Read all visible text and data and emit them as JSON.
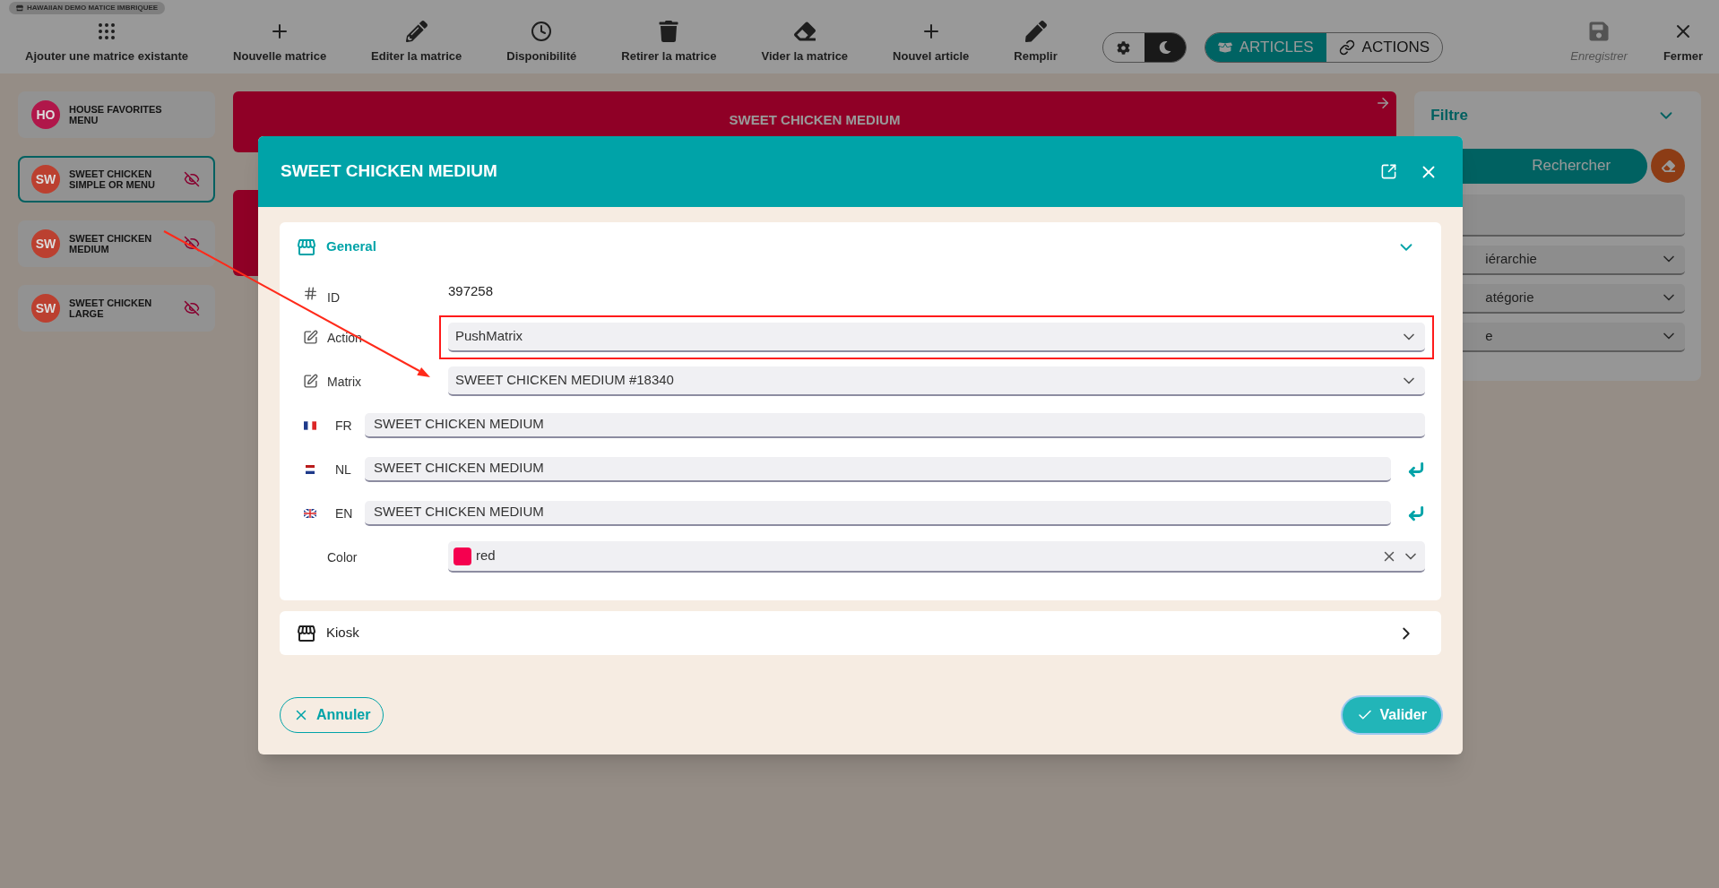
{
  "app_title": "HAWAIIAN DEMO MATICE IMBRIQUEE",
  "toolbar": [
    {
      "label": "Ajouter une matrice existante",
      "disabled": false
    },
    {
      "label": "Nouvelle matrice",
      "disabled": false
    },
    {
      "label": "Editer la matrice",
      "disabled": false
    },
    {
      "label": "Disponibilité",
      "disabled": false
    },
    {
      "label": "Retirer la matrice",
      "disabled": false
    },
    {
      "label": "Vider la matrice",
      "disabled": false
    },
    {
      "label": "Nouvel article",
      "disabled": false
    },
    {
      "label": "Remplir",
      "disabled": false
    }
  ],
  "theme_options": [
    {
      "selected": false
    },
    {
      "selected": true
    }
  ],
  "view_tabs": [
    {
      "label": "ARTICLES",
      "selected": true
    },
    {
      "label": "ACTIONS",
      "selected": false
    }
  ],
  "window_actions": [
    {
      "label": "Enregistrer",
      "disabled": true
    },
    {
      "label": "Fermer",
      "disabled": false
    }
  ],
  "sidebar": [
    {
      "initials": "HO",
      "name": "HOUSE FAVORITES MENU",
      "color": "#b0174a",
      "selected": false,
      "hidden": false
    },
    {
      "initials": "SW",
      "name": "SWEET CHICKEN SIMPLE OR MENU",
      "color": "#bb4030",
      "selected": true,
      "hidden": true
    },
    {
      "initials": "SW",
      "name": "SWEET CHICKEN MEDIUM",
      "color": "#bb4030",
      "selected": false,
      "hidden": true
    },
    {
      "initials": "SW",
      "name": "SWEET CHICKEN LARGE",
      "color": "#bb4030",
      "selected": false,
      "hidden": true
    }
  ],
  "matrix_cards": [
    {
      "title": "SWEET CHICKEN MEDIUM"
    }
  ],
  "filter": {
    "title": "Filtre",
    "expanded": true,
    "search_button": "Rechercher",
    "fields": [
      {
        "kind": "input"
      },
      {
        "kind": "select",
        "value": "iérarchie"
      },
      {
        "kind": "select",
        "value": "atégorie"
      },
      {
        "kind": "select",
        "value": "e"
      }
    ]
  },
  "dialog": {
    "title": "SWEET CHICKEN MEDIUM",
    "sections": [
      {
        "title": "General",
        "expanded": true,
        "fields": [
          {
            "kind": "id",
            "label": "ID",
            "value": "397258"
          },
          {
            "kind": "select",
            "label": "Action",
            "value": "PushMatrix",
            "highlighted": true
          },
          {
            "kind": "select",
            "label": "Matrix",
            "value": "SWEET CHICKEN MEDIUM #18340",
            "highlighted": false
          },
          {
            "kind": "translation",
            "label": "FR",
            "value": "SWEET CHICKEN MEDIUM",
            "copy": false
          },
          {
            "kind": "translation",
            "label": "NL",
            "value": "SWEET CHICKEN MEDIUM",
            "copy": true
          },
          {
            "kind": "translation",
            "label": "EN",
            "value": "SWEET CHICKEN MEDIUM",
            "copy": true
          },
          {
            "kind": "color",
            "label": "Color",
            "value": "red",
            "color": "#f5004f"
          }
        ]
      },
      {
        "title": "Kiosk",
        "expanded": false
      }
    ],
    "cancel": "Annuler",
    "confirm": "Valider"
  }
}
